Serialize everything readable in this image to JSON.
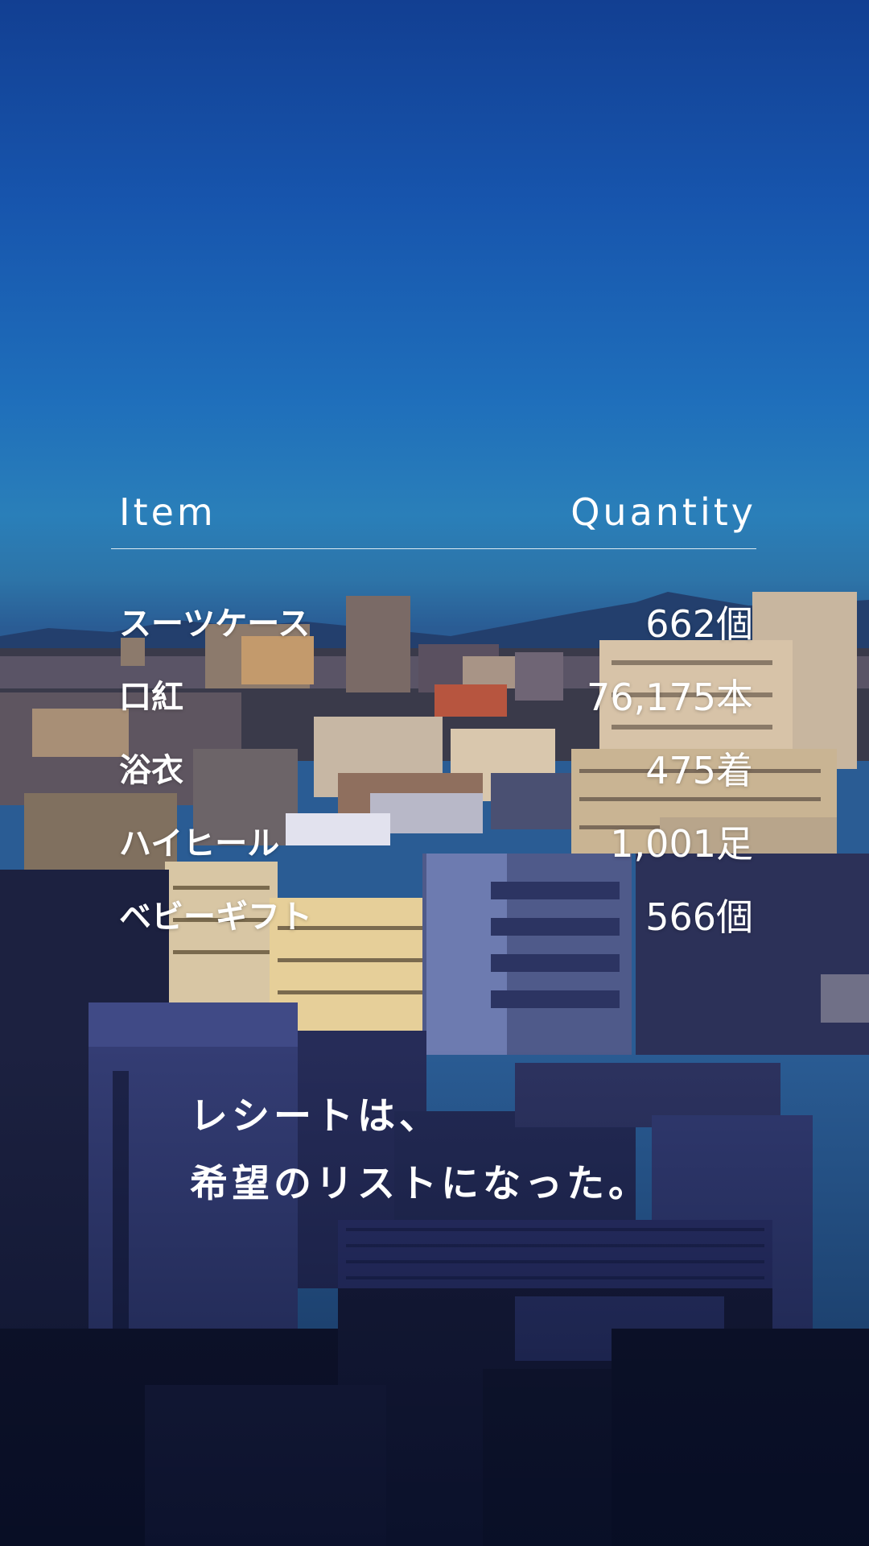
{
  "table": {
    "header": {
      "item_label": "Item",
      "quantity_label": "Quantity"
    },
    "rows": [
      {
        "item": "スーツケース",
        "quantity": "662個"
      },
      {
        "item": "口紅",
        "quantity": "76,175本"
      },
      {
        "item": "浴衣",
        "quantity": "475着"
      },
      {
        "item": "ハイヒール",
        "quantity": "1,001足"
      },
      {
        "item": "ベビーギフト",
        "quantity": "566個"
      }
    ]
  },
  "tagline": {
    "line1": "レシートは、",
    "line2": "希望のリストになった。"
  },
  "colors": {
    "sky_top": "#123f92",
    "sky_horizon": "#2a7fb9",
    "text": "#ffffff"
  }
}
